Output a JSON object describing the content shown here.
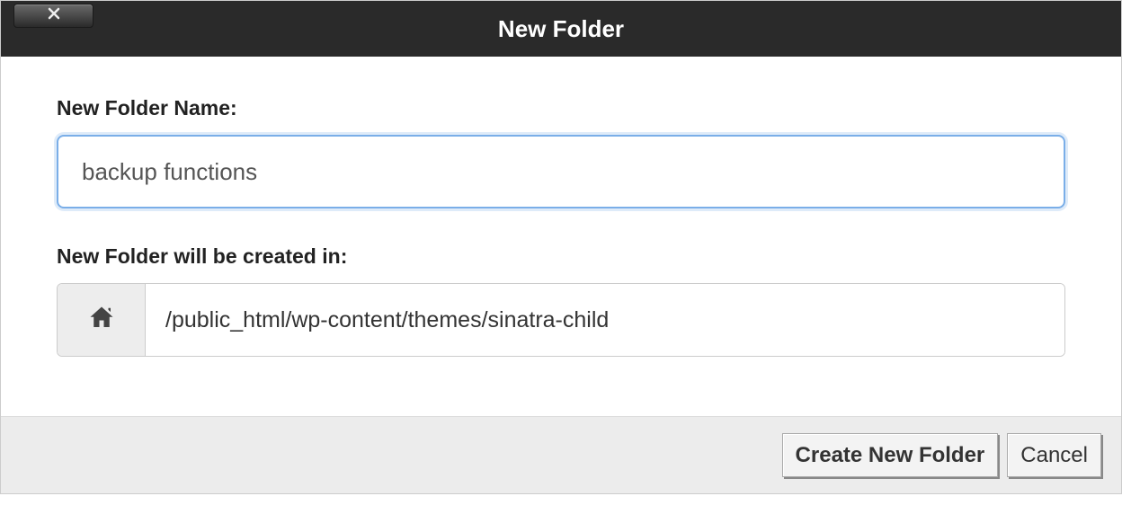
{
  "dialog": {
    "title": "New Folder",
    "nameLabel": "New Folder Name:",
    "nameValue": "backup functions",
    "pathLabel": "New Folder will be created in:",
    "pathValue": "/public_html/wp-content/themes/sinatra-child",
    "createButton": "Create New Folder",
    "cancelButton": "Cancel"
  }
}
